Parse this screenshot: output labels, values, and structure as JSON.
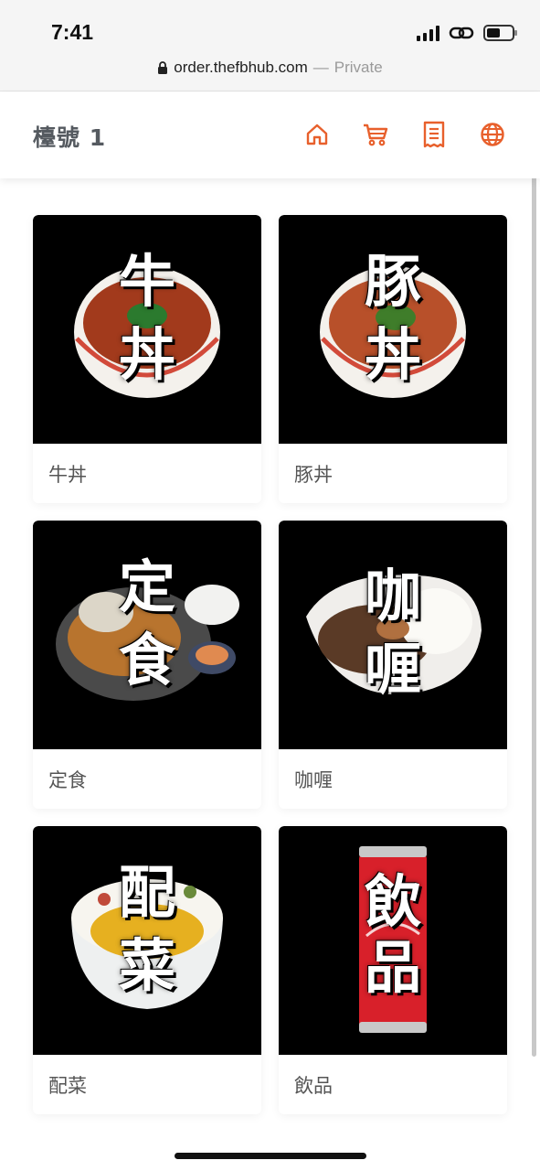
{
  "status_bar": {
    "time": "7:41",
    "url": "order.thefbhub.com",
    "url_separator": "—",
    "mode": "Private"
  },
  "header": {
    "table_label": "檯號 1",
    "icons": [
      "home-icon",
      "cart-icon",
      "receipt-icon",
      "globe-icon"
    ],
    "accent_color": "#e8602c"
  },
  "categories": [
    {
      "label": "牛丼",
      "overlay": [
        "牛",
        "丼"
      ]
    },
    {
      "label": "豚丼",
      "overlay": [
        "豚",
        "丼"
      ]
    },
    {
      "label": "定食",
      "overlay": [
        "定",
        "食"
      ]
    },
    {
      "label": "咖喱",
      "overlay": [
        "咖",
        "喱"
      ]
    },
    {
      "label": "配菜",
      "overlay": [
        "配",
        "菜"
      ]
    },
    {
      "label": "飲品",
      "overlay": [
        "飲",
        "品"
      ]
    }
  ]
}
